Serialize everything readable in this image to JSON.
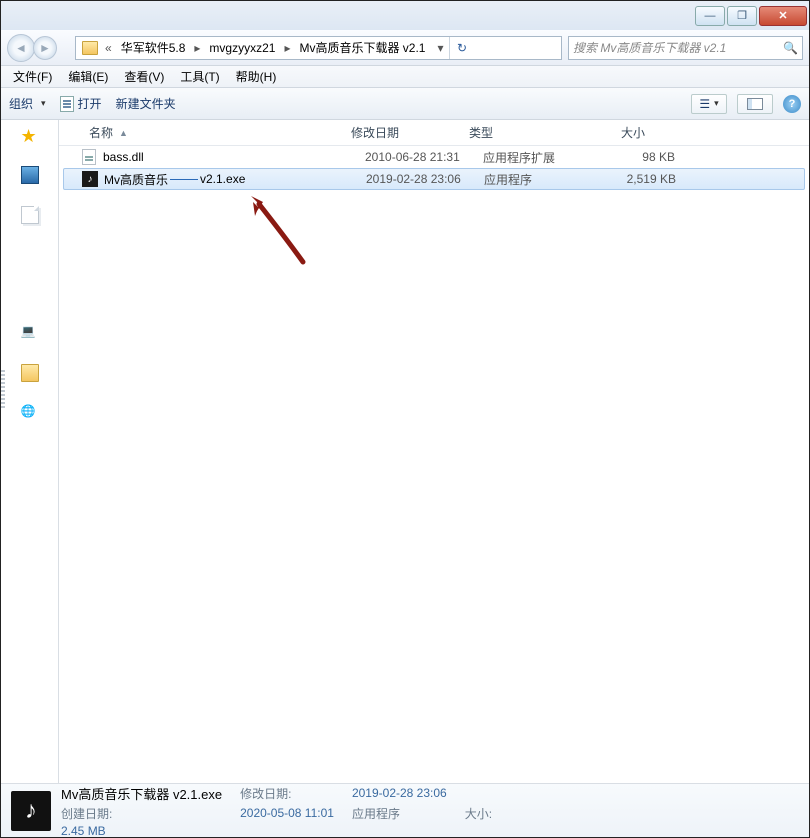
{
  "titlebar": {
    "min_tip": "—",
    "max_tip": "❐",
    "close_tip": "✕"
  },
  "path": {
    "sep": "«",
    "segments": [
      "华军软件5.8",
      "mvgzyyxz21",
      "Mv高质音乐下载器 v2.1"
    ]
  },
  "search": {
    "placeholder": "搜索 Mv高质音乐下载器 v2.1"
  },
  "menu": {
    "file": "文件(F)",
    "edit": "编辑(E)",
    "view": "查看(V)",
    "tools": "工具(T)",
    "help": "帮助(H)"
  },
  "toolbar": {
    "organize": "组织",
    "open": "打开",
    "new_folder": "新建文件夹"
  },
  "columns": {
    "name": "名称",
    "date": "修改日期",
    "type": "类型",
    "size": "大小"
  },
  "files": [
    {
      "name": "bass.dll",
      "date": "2010-06-28 21:31",
      "type": "应用程序扩展",
      "size": "98 KB",
      "icon": "dll"
    },
    {
      "name_a": "Mv高质音乐",
      "name_b": "v2.1.exe",
      "date": "2019-02-28 23:06",
      "type": "应用程序",
      "size": "2,519 KB",
      "icon": "exe"
    }
  ],
  "details": {
    "title": "Mv高质音乐下载器 v2.1.exe",
    "type": "应用程序",
    "mod_label": "修改日期:",
    "mod_val": "2019-02-28 23:06",
    "create_label": "创建日期:",
    "create_val": "2020-05-08 11:01",
    "size_label": "大小:",
    "size_val": "2.45 MB"
  }
}
